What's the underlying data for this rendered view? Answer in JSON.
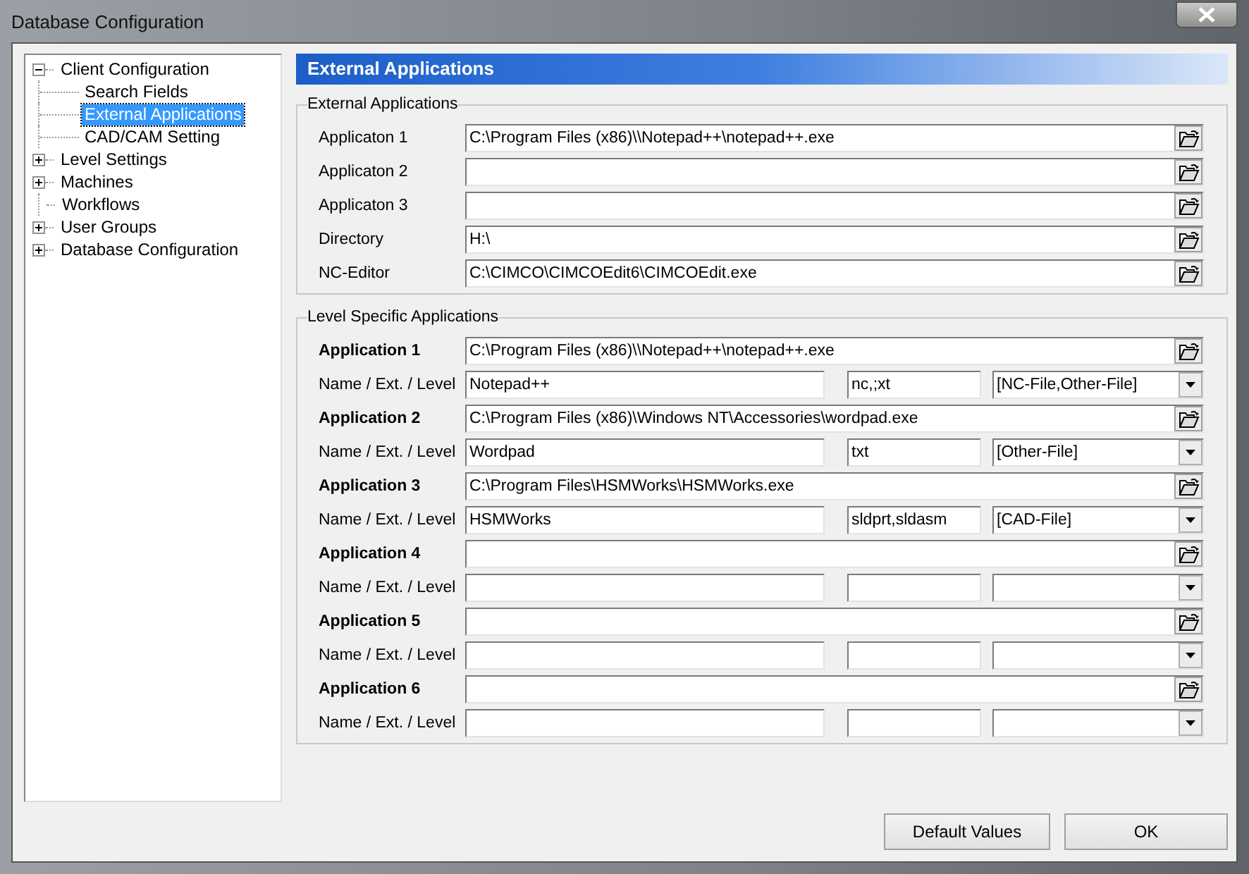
{
  "window": {
    "title": "Database Configuration"
  },
  "tree": [
    {
      "label": "Client Configuration",
      "kind": "group",
      "expanded": true,
      "selected": false,
      "children": [
        {
          "label": "Search Fields",
          "selected": false
        },
        {
          "label": "External Applications",
          "selected": true
        },
        {
          "label": "CAD/CAM Setting",
          "selected": false
        }
      ]
    },
    {
      "label": "Level Settings",
      "kind": "group",
      "expanded": false,
      "selected": false
    },
    {
      "label": "Machines",
      "kind": "group",
      "expanded": false,
      "selected": false
    },
    {
      "label": "Workflows",
      "kind": "leaf",
      "selected": false
    },
    {
      "label": "User Groups",
      "kind": "group",
      "expanded": false,
      "selected": false
    },
    {
      "label": "Database Configuration",
      "kind": "group",
      "expanded": false,
      "selected": false
    }
  ],
  "panel": {
    "title": "External Applications",
    "general": {
      "title": "External Applications",
      "fields": [
        {
          "label": "Applicaton 1",
          "value": "C:\\Program Files (x86)\\\\Notepad++\\notepad++.exe"
        },
        {
          "label": "Applicaton 2"
        },
        {
          "label": "Applicaton 3"
        },
        {
          "label": "Directory",
          "value": "H:\\"
        },
        {
          "label": "NC-Editor",
          "value": "C:\\CIMCO\\CIMCOEdit6\\CIMCOEdit.exe"
        }
      ]
    },
    "level_specific": {
      "title": "Level Specific Applications",
      "apps": [
        {
          "label": "Application 1",
          "path": "C:\\Program Files (x86)\\\\Notepad++\\notepad++.exe",
          "name_label": "Name / Ext. / Level",
          "name": "Notepad++",
          "ext": "nc,;xt",
          "level": "[NC-File,Other-File]"
        },
        {
          "label": "Application 2",
          "path": "C:\\Program Files (x86)\\Windows NT\\Accessories\\wordpad.exe",
          "name_label": "Name / Ext. / Level",
          "name": "Wordpad",
          "ext": "txt",
          "level": "[Other-File]"
        },
        {
          "label": "Application 3",
          "path": "C:\\Program Files\\HSMWorks\\HSMWorks.exe",
          "name_label": "Name / Ext. / Level",
          "name": "HSMWorks",
          "ext": "sldprt,sldasm",
          "level": "[CAD-File]"
        },
        {
          "label": "Application 4",
          "name_label": "Name / Ext. / Level"
        },
        {
          "label": "Application 5",
          "name_label": "Name / Ext. / Level"
        },
        {
          "label": "Application 6",
          "name_label": "Name / Ext. / Level"
        }
      ]
    }
  },
  "buttons": [
    "Default Values",
    "OK"
  ]
}
